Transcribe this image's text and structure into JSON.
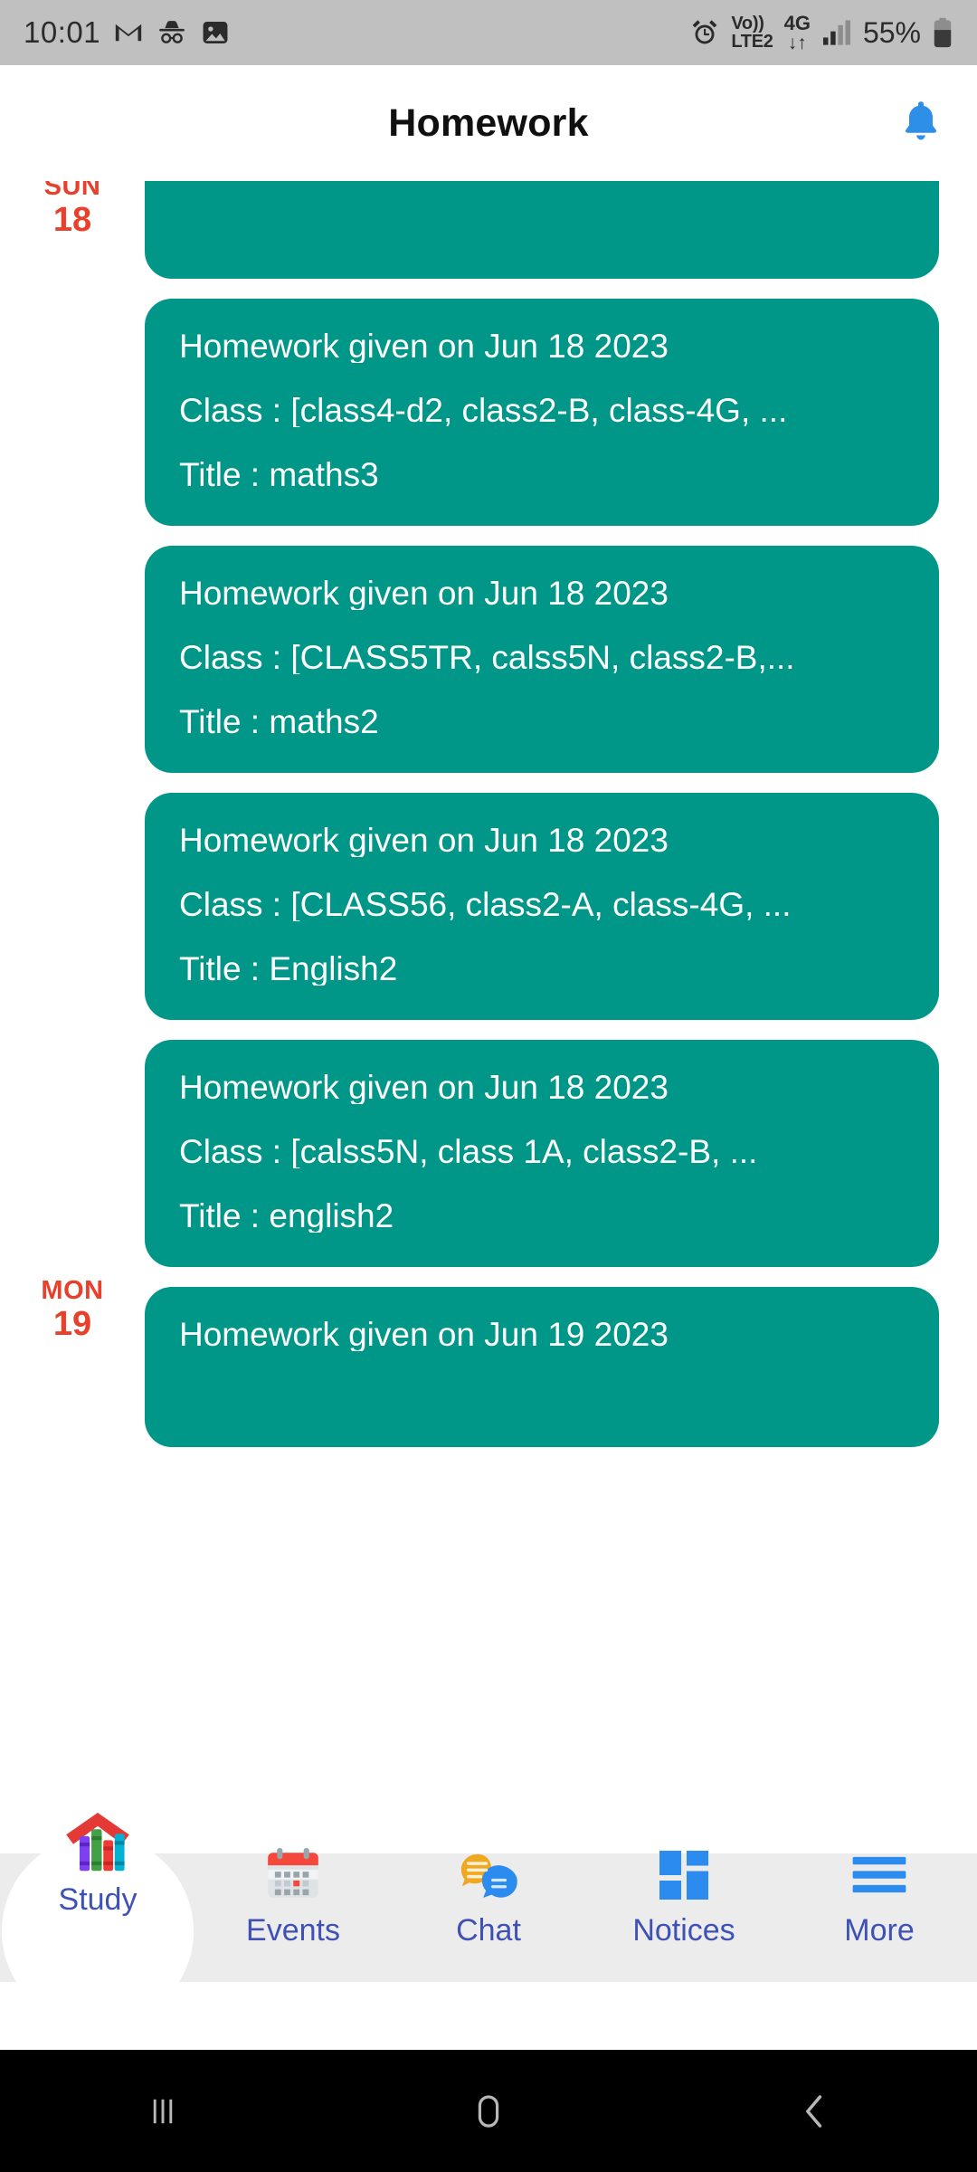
{
  "status_bar": {
    "time": "10:01",
    "left_icons": [
      "gmail-icon",
      "incognito-icon",
      "gallery-icon"
    ],
    "alarm_icon": "alarm-icon",
    "volte_line1": "Vo))",
    "volte_line2": "LTE2",
    "network_type": "4G",
    "data_arrows": "↓↑",
    "signal_icon": "signal-bars-icon",
    "battery_percent": "55%",
    "battery_icon": "battery-icon",
    "background_color": "#c0c0c0"
  },
  "app_bar": {
    "title": "Homework",
    "notification_icon": "bell-icon",
    "notification_color": "#2e8fe8"
  },
  "theme": {
    "card_color": "#009688",
    "date_color": "#e8402a",
    "nav_label_color": "#3f51b5",
    "nav_bar_color": "#ececec"
  },
  "day_groups": [
    {
      "day_of_week": "SUN",
      "day_number": "18",
      "cards": [
        {
          "clipped": true,
          "heading": "",
          "class_line": "",
          "title_line": ""
        },
        {
          "clipped": false,
          "heading": "Homework given on Jun 18 2023",
          "class_line": "Class : [class4-d2, class2-B, class-4G, ...",
          "title_line": "Title : maths3"
        },
        {
          "clipped": false,
          "heading": "Homework given on Jun 18 2023",
          "class_line": "Class : [CLASS5TR, calss5N, class2-B,...",
          "title_line": "Title : maths2"
        },
        {
          "clipped": false,
          "heading": "Homework given on Jun 18 2023",
          "class_line": "Class : [CLASS56, class2-A, class-4G, ...",
          "title_line": "Title : English2"
        },
        {
          "clipped": false,
          "heading": "Homework given on Jun 18 2023",
          "class_line": "Class : [calss5N, class 1A, class2-B, ...",
          "title_line": "Title : english2"
        }
      ]
    },
    {
      "day_of_week": "MON",
      "day_number": "19",
      "cards": [
        {
          "clipped": false,
          "heading": "Homework given on Jun 19 2023",
          "class_line": "",
          "title_line": ""
        }
      ]
    }
  ],
  "bottom_nav": {
    "items": [
      {
        "label": "Study",
        "icon": "school-books-icon",
        "active": true
      },
      {
        "label": "Events",
        "icon": "calendar-icon",
        "active": false
      },
      {
        "label": "Chat",
        "icon": "chat-bubbles-icon",
        "active": false
      },
      {
        "label": "Notices",
        "icon": "grid-icon",
        "active": false
      },
      {
        "label": "More",
        "icon": "hamburger-icon",
        "active": false
      }
    ]
  },
  "system_nav": {
    "recents_icon": "recents-icon",
    "home_icon": "home-icon",
    "back_icon": "back-icon"
  }
}
